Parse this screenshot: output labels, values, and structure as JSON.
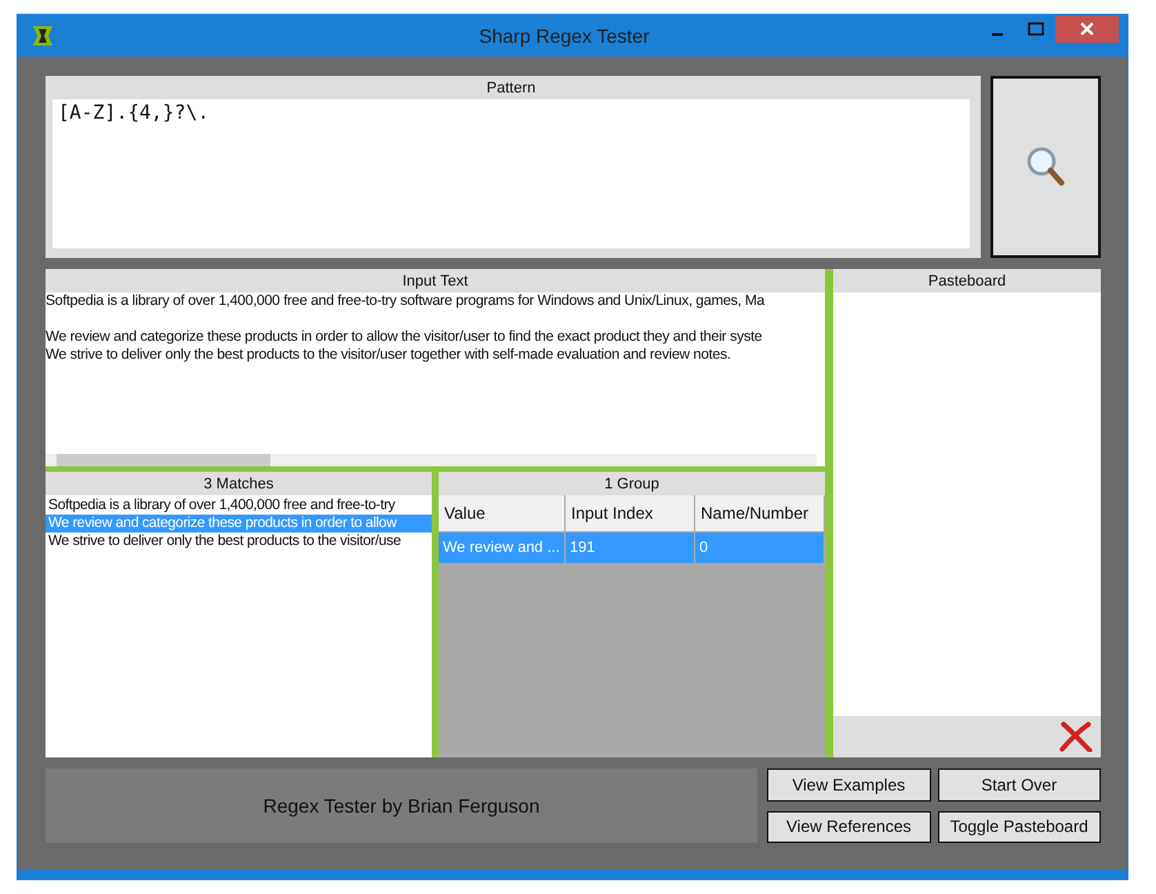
{
  "window": {
    "title": "Sharp Regex Tester"
  },
  "pattern": {
    "label": "Pattern",
    "value": "[A-Z].{4,}?\\."
  },
  "input_text": {
    "label": "Input Text",
    "paragraphs": [
      [
        "Softpedia is a library of over 1,400,000 free and free-to-try software programs for Windows and Unix/Linux, games, Ma"
      ],
      [
        "We review and categorize these products in order to allow the visitor/user to find the exact product they and their syste",
        "We strive to deliver only the best products to the visitor/user together with self-made evaluation and review notes."
      ]
    ]
  },
  "matches": {
    "label": "3 Matches",
    "items": [
      {
        "text": "Softpedia is a library of over 1,400,000 free and free-to-try",
        "selected": false
      },
      {
        "text": "We review and categorize these products in order to allow",
        "selected": true
      },
      {
        "text": "We strive to deliver only the best products to the visitor/use",
        "selected": false
      }
    ]
  },
  "groups": {
    "label": "1 Group",
    "columns": [
      "Value",
      "Input Index",
      "Name/Number"
    ],
    "rows": [
      {
        "cells": [
          "We review and ...",
          "191",
          "0"
        ],
        "selected": true
      }
    ]
  },
  "pasteboard": {
    "label": "Pasteboard"
  },
  "credit": "Regex Tester by Brian Ferguson",
  "buttons": [
    "View Examples",
    "Start Over",
    "View References",
    "Toggle Pasteboard"
  ]
}
